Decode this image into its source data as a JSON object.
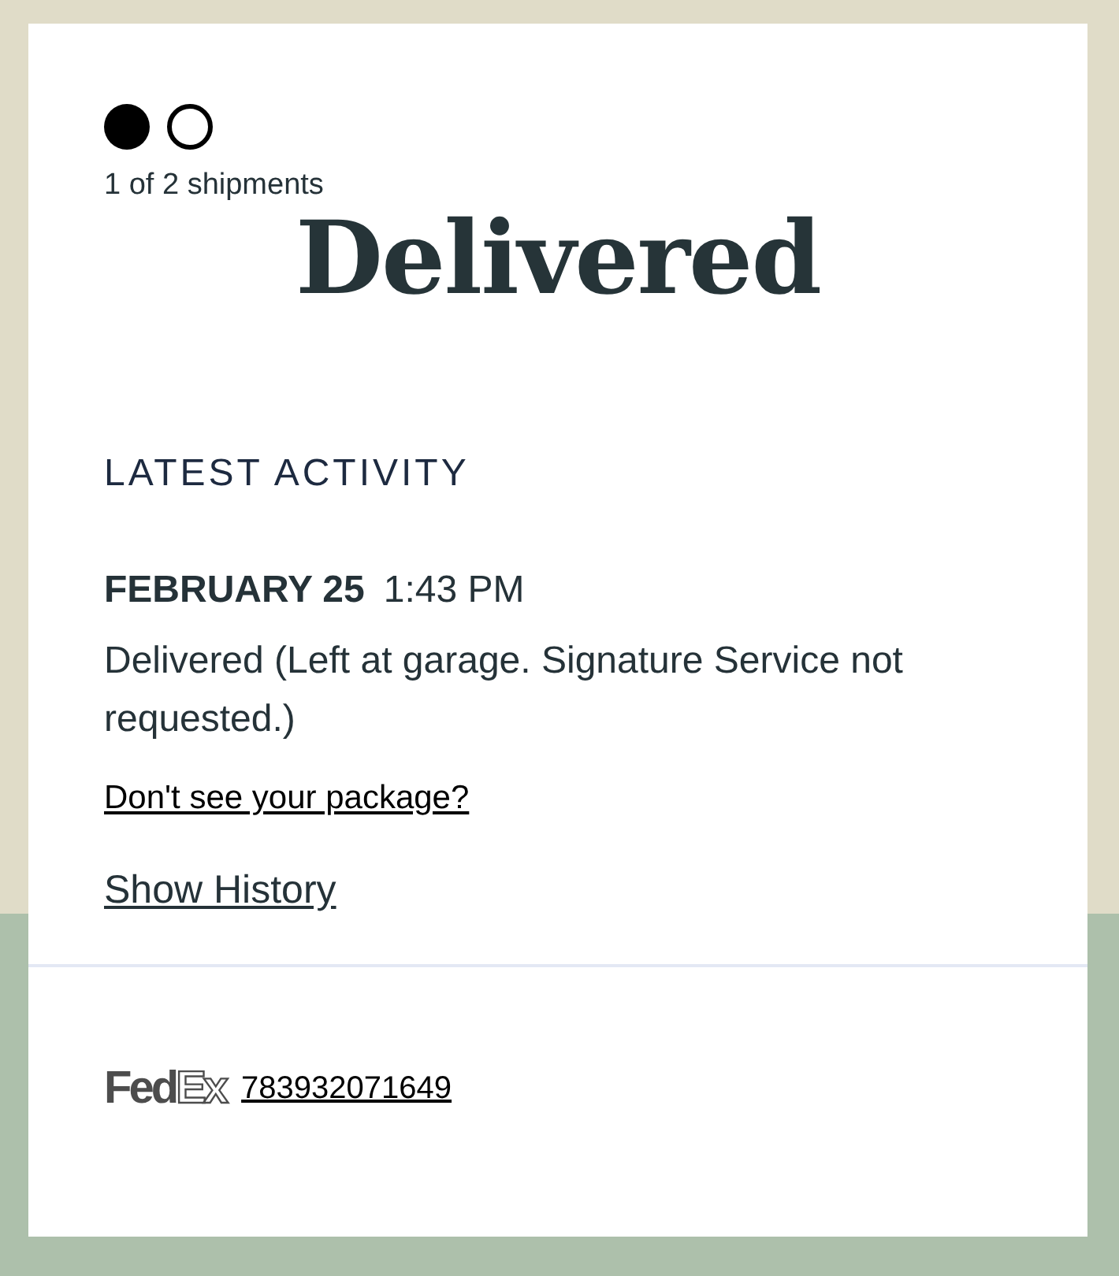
{
  "shipment_dots": [
    {
      "selected": true
    },
    {
      "selected": false
    }
  ],
  "shipment_count": "1 of 2 shipments",
  "status": "Delivered",
  "latest_activity": {
    "heading": "LATEST ACTIVITY",
    "date": "FEBRUARY 25",
    "time": "1:43 PM",
    "description": "Delivered (Left at garage. Signature Service not requested.)"
  },
  "links": [
    "Don't see your package?",
    "Show History"
  ],
  "carrier": {
    "logo": [
      "Fed",
      "Ex"
    ],
    "tracking_number": "783932071649"
  }
}
